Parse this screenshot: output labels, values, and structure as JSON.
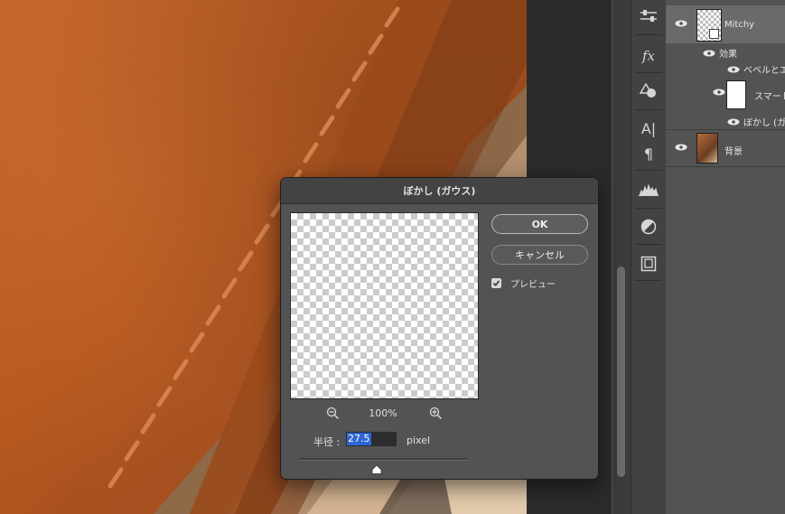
{
  "dialog": {
    "title": "ぼかし (ガウス)",
    "ok_label": "OK",
    "cancel_label": "キャンセル",
    "preview_label": "プレビュー",
    "preview_checked": true,
    "zoom_level": "100%",
    "radius_label": "半径 :",
    "radius_value": "27.5",
    "unit_label": "pixel",
    "slider_value_fraction": 0.46
  },
  "layers": {
    "items": [
      {
        "name": "Mitchy",
        "type": "smart-object"
      },
      {
        "name": "効果",
        "type": "effects"
      },
      {
        "name": "ベベルとエ",
        "type": "effect"
      },
      {
        "name": "スマート",
        "type": "smart-filter"
      },
      {
        "name": "ぼかし (ガ",
        "type": "filter"
      },
      {
        "name": "背景",
        "type": "background"
      }
    ]
  },
  "toolstrip": {
    "icons": [
      "adjustments-icon",
      "fx-icon",
      "shape-icon",
      "character-icon",
      "paragraph-icon",
      "histogram-icon",
      "adjustment-circle-icon",
      "navigator-icon"
    ]
  },
  "colors": {
    "canvas_leather": "#b85a22",
    "panel": "#535353",
    "dark": "#2b2b2b",
    "accent_selection": "#2f66d6"
  }
}
